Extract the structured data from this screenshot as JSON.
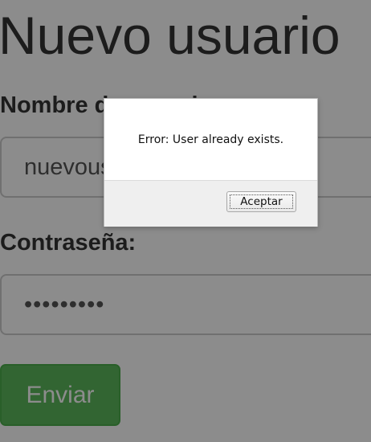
{
  "form": {
    "title": "Nuevo usuario",
    "username_label": "Nombre de usuario:",
    "username_value": "nuevousuario",
    "password_label": "Contraseña:",
    "password_value": "•••••••••",
    "submit_label": "Enviar"
  },
  "alert": {
    "message": "Error: User already exists.",
    "accept_label": "Aceptar"
  },
  "colors": {
    "submit_button": "#5cb85c",
    "overlay": "rgba(0,0,0,0.45)"
  }
}
